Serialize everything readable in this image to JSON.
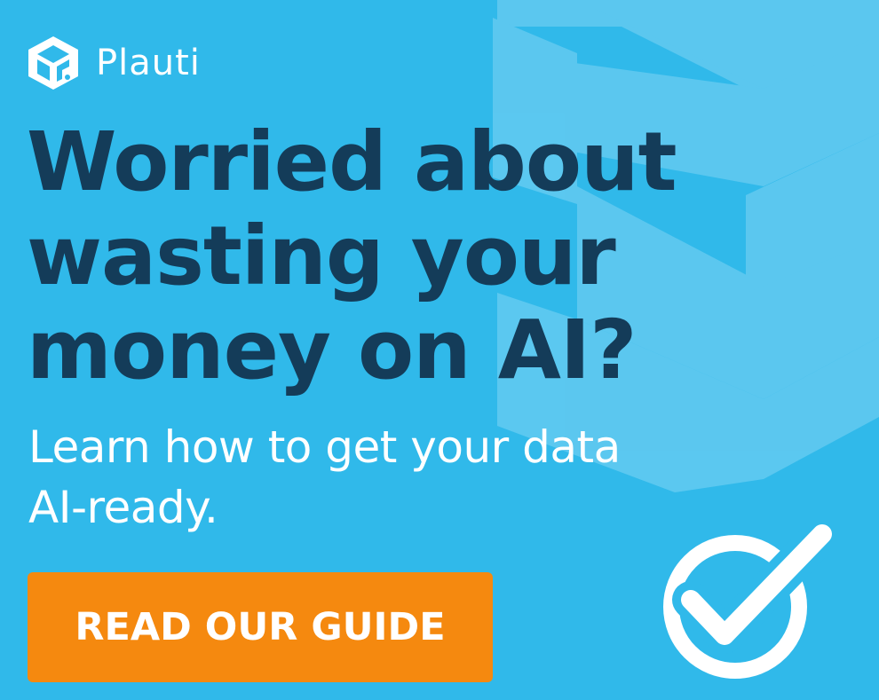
{
  "brand": {
    "name": "Plauti",
    "logo_icon": "plauti-logo-icon"
  },
  "headline": {
    "lines": [
      "Worried about",
      "wasting your",
      "money on AI?"
    ]
  },
  "subhead": {
    "lines": [
      "Learn how to get your data",
      "AI-ready."
    ]
  },
  "cta": {
    "label": "READ OUR GUIDE"
  },
  "decorations": {
    "badge_icon": "checkmark-circle-icon",
    "background_icon": "plauti-shape-icon"
  },
  "colors": {
    "background": "#30b9ea",
    "headline": "#143c59",
    "cta": "#f5890f",
    "text_light": "#ffffff"
  }
}
